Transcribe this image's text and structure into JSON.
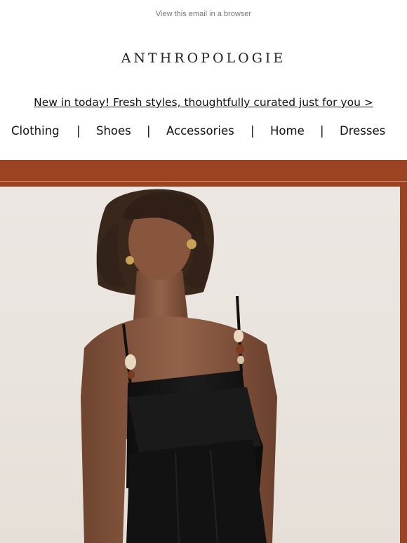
{
  "header": {
    "view_in_browser": "View this email in a browser",
    "logo": "ANTHROPOLOGIE",
    "promo": "New in today! Fresh styles, thoughtfully curated just for you >"
  },
  "nav": {
    "items": [
      "Clothing",
      "Shoes",
      "Accessories",
      "Home",
      "Dresses"
    ],
    "separator": "|"
  },
  "colors": {
    "accent_band": "#9c4322",
    "dress": "#141414",
    "skin": "#8a5a3e",
    "backdrop": "#ece7e2"
  }
}
